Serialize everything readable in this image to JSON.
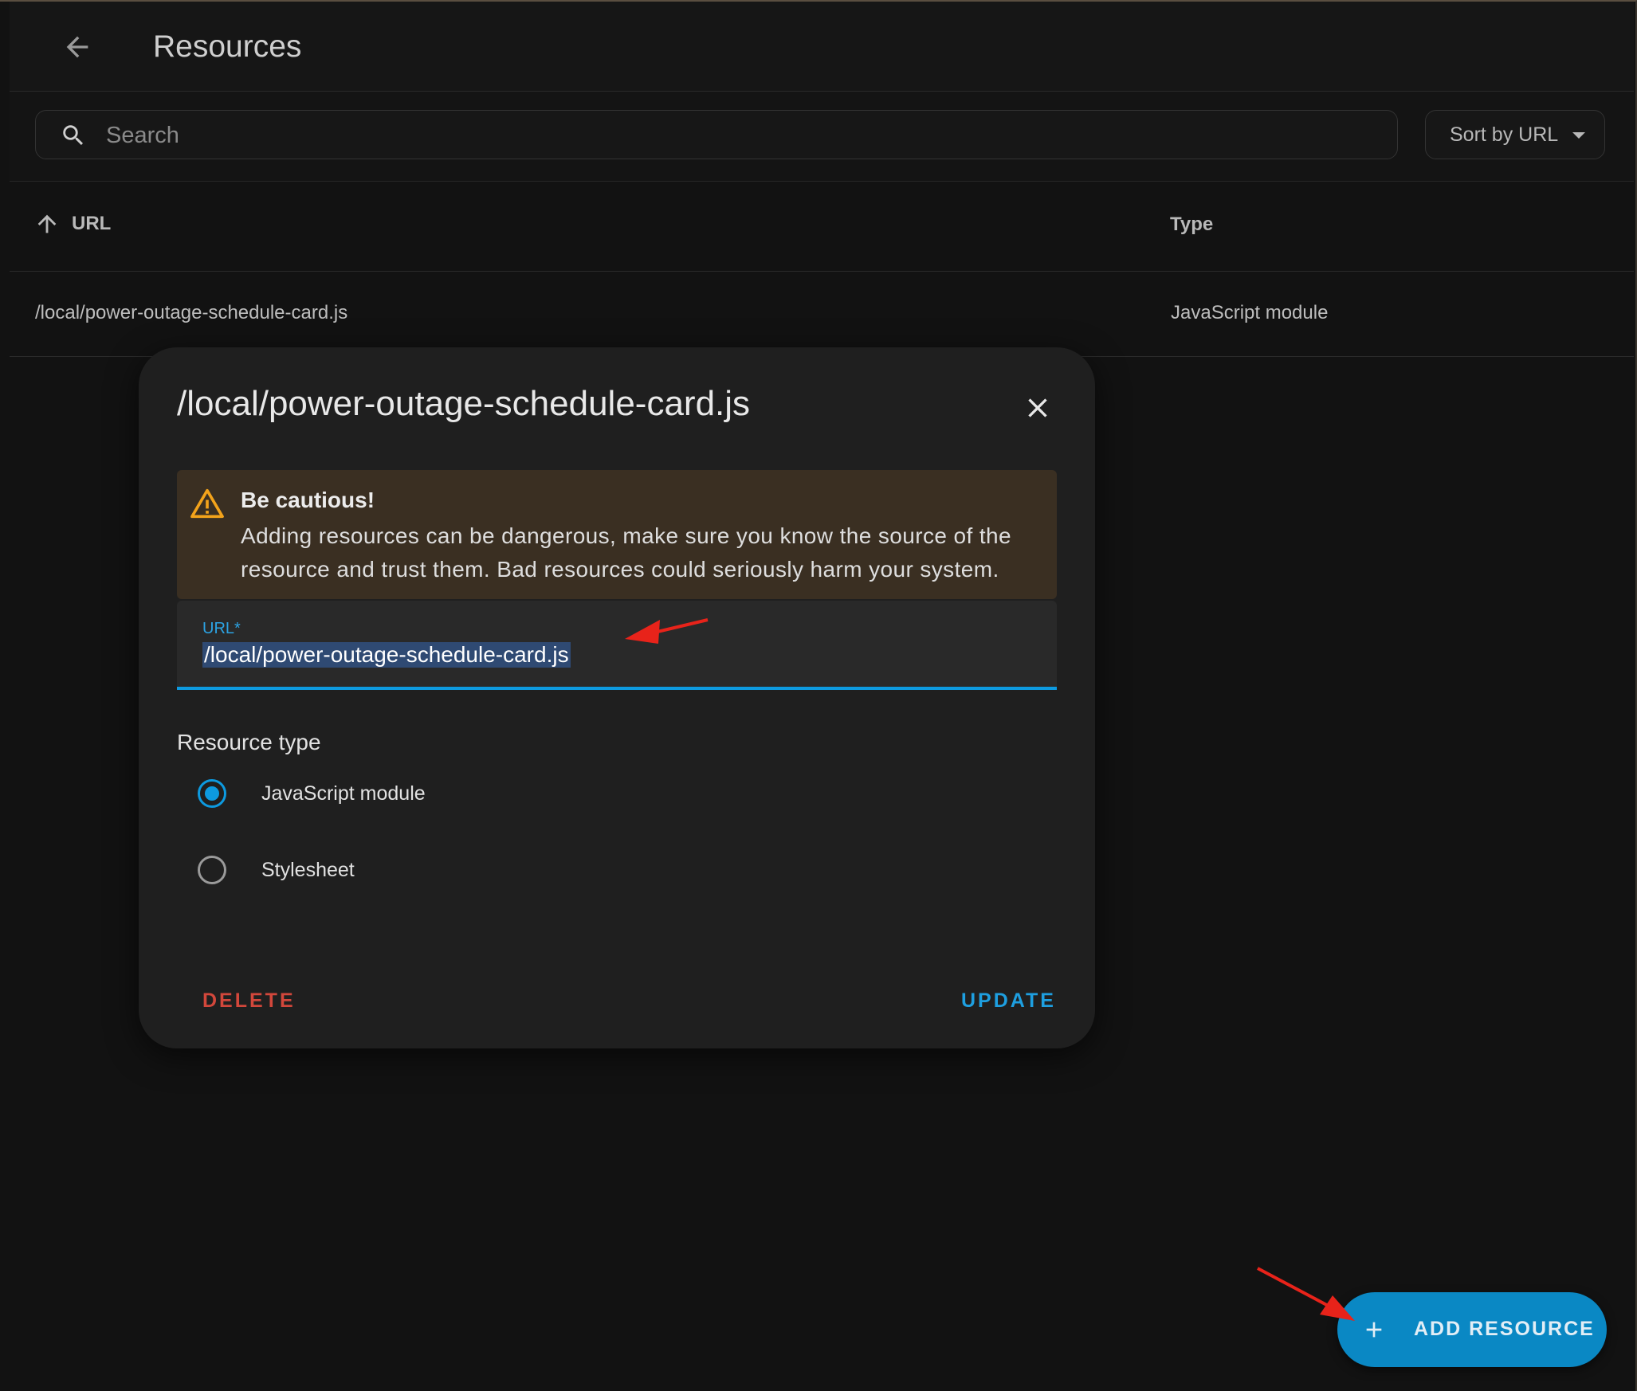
{
  "header": {
    "title": "Resources"
  },
  "toolbar": {
    "search_placeholder": "Search",
    "sort_label": "Sort by URL"
  },
  "table": {
    "columns": [
      "URL",
      "Type"
    ],
    "rows": [
      {
        "url": "/local/power-outage-schedule-card.js",
        "type": "JavaScript module"
      }
    ]
  },
  "dialog": {
    "title": "/local/power-outage-schedule-card.js",
    "warning": {
      "title": "Be cautious!",
      "text": "Adding resources can be dangerous, make sure you know the source of the resource and trust them. Bad resources could seriously harm your system."
    },
    "url_field": {
      "label": "URL*",
      "value": "/local/power-outage-schedule-card.js"
    },
    "resource_type_label": "Resource type",
    "options": [
      {
        "label": "JavaScript module",
        "checked": true
      },
      {
        "label": "Stylesheet",
        "checked": false
      }
    ],
    "delete_label": "DELETE",
    "update_label": "UPDATE"
  },
  "fab": {
    "label": "ADD RESOURCE"
  },
  "colors": {
    "accent": "#0d9ae0",
    "danger": "#d2473b",
    "warning_bg": "#3a2f22",
    "annotation_arrow": "#e8231a"
  }
}
